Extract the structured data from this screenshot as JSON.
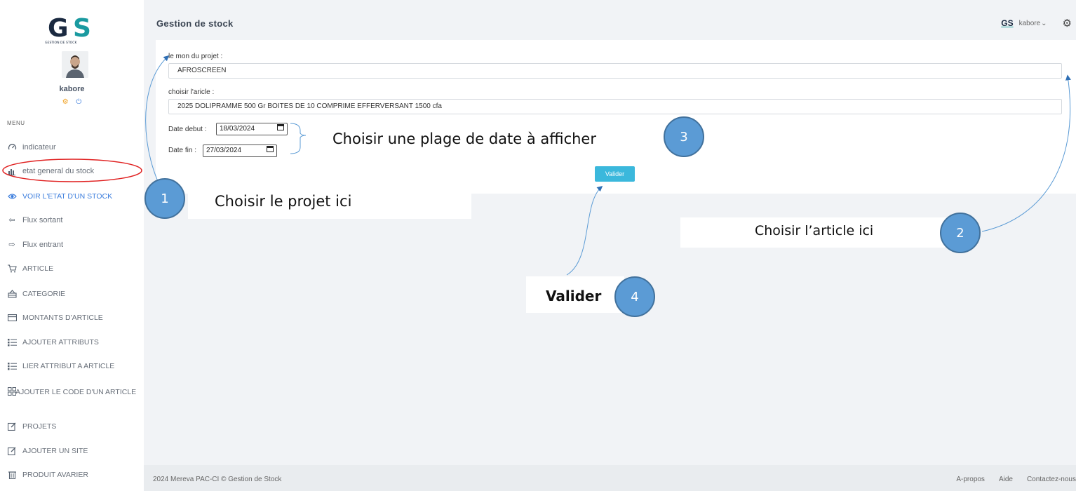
{
  "sidebar": {
    "logo_text": "GS",
    "logo_subtext": "GESTION DE STOCK",
    "username": "kabore",
    "menu_title": "MENU",
    "items": [
      {
        "label": "indicateur",
        "icon": "dashboard-icon"
      },
      {
        "label": "etat general du stock",
        "icon": "bar-chart-icon"
      },
      {
        "label": "VOIR L'ETAT D'UN STOCK",
        "icon": "eye-icon"
      },
      {
        "label": "Flux sortant",
        "icon": "arrow-left-icon"
      },
      {
        "label": "Flux entrant",
        "icon": "arrow-right-icon"
      },
      {
        "label": "ARTICLE",
        "icon": "cart-icon"
      },
      {
        "label": "CATEGORIE",
        "icon": "category-icon"
      },
      {
        "label": "MONTANTS D'ARTICLE",
        "icon": "credit-card-icon"
      },
      {
        "label": "AJOUTER ATTRIBUTS",
        "icon": "list-icon"
      },
      {
        "label": "LIER ATTRIBUT A ARTICLE",
        "icon": "list-icon"
      },
      {
        "label": "AJOUTER LE CODE D'UN ARTICLE",
        "icon": "grid-icon"
      },
      {
        "label": "PROJETS",
        "icon": "edit-icon"
      },
      {
        "label": "AJOUTER UN SITE",
        "icon": "edit-icon"
      },
      {
        "label": "PRODUIT AVARIER",
        "icon": "trash-icon"
      }
    ]
  },
  "header": {
    "title": "Gestion de stock",
    "user": "kabore",
    "user_chevron": "⌄"
  },
  "form": {
    "project_label": "le mon du projet  :",
    "project_value": "AFROSCREEN",
    "article_label": "choisir l'aricle  :",
    "article_value": "2025 DOLIPRAMME 500 Gr BOITES DE 10 COMPRIME EFFERVERSANT 1500 cfa",
    "date_debut_label": "Date debut :",
    "date_debut_value": "18/03/2024",
    "date_fin_label": "Date fin :",
    "date_fin_value": "27/03/2024",
    "submit_label": "Valider"
  },
  "annotations": {
    "step1_text": "Choisir le projet ici",
    "step2_text": "Choisir l’article ici",
    "step3_text": "Choisir une plage de date à afficher",
    "step4_text": "Valider",
    "step1_num": "1",
    "step2_num": "2",
    "step3_num": "3",
    "step4_num": "4"
  },
  "footer": {
    "copyright": "2024 Mereva PAC-CI © Gestion de Stock",
    "links": [
      "A-propos",
      "Aide",
      "Contactez-nous"
    ]
  },
  "colors": {
    "accent": "#3b7ddd",
    "annotation_circle": "#5b9bd5",
    "highlight_ring": "#e02020",
    "button": "#3bb8dc"
  }
}
